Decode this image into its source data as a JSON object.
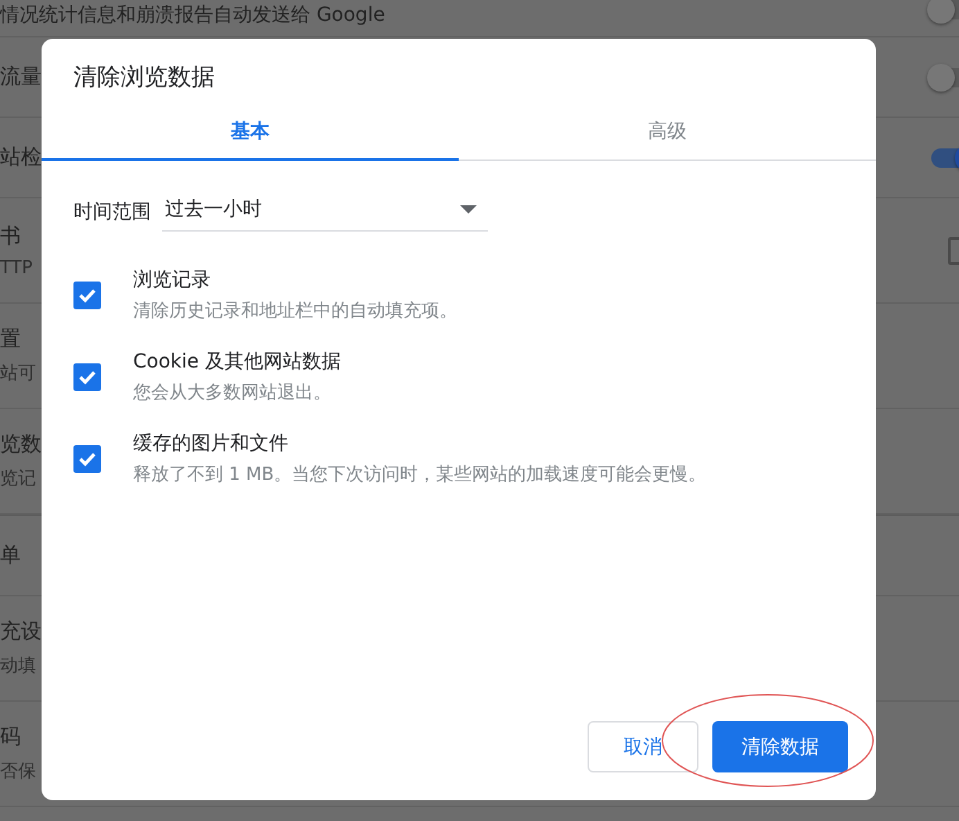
{
  "settings_sections": [
    {
      "rows": [
        {
          "title": "情况统计信息和崩溃报告自动发送给 Google",
          "control": {
            "kind": "toggle",
            "on": false
          }
        },
        {
          "title": "流量",
          "control": {
            "kind": "toggle",
            "on": false
          }
        },
        {
          "title": "站检",
          "control": {
            "kind": "toggle",
            "on": true
          }
        },
        {
          "title": "书",
          "subtitle": "TTP",
          "control": {
            "kind": "checkbox",
            "checked": false
          }
        },
        {
          "title": "置",
          "subtitle": "站可"
        },
        {
          "title": "览数",
          "subtitle": "览记"
        }
      ]
    },
    {
      "rows": [
        {
          "title": "单"
        },
        {
          "title": "充设",
          "subtitle": "动填"
        },
        {
          "title": "码",
          "subtitle": "否保"
        }
      ]
    }
  ],
  "dialog": {
    "title": "清除浏览数据",
    "tabs": [
      {
        "label": "基本",
        "selected": true
      },
      {
        "label": "高级",
        "selected": false
      }
    ],
    "time_range": {
      "label": "时间范围",
      "value": "过去一小时"
    },
    "options": [
      {
        "title": "浏览记录",
        "description": "清除历史记录和地址栏中的自动填充项。",
        "checked": true
      },
      {
        "title": "Cookie 及其他网站数据",
        "description": "您会从大多数网站退出。",
        "checked": true
      },
      {
        "title": "缓存的图片和文件",
        "description": "释放了不到 1 MB。当您下次访问时，某些网站的加载速度可能会更慢。",
        "checked": true
      }
    ],
    "buttons": [
      {
        "label": "取消",
        "kind": "secondary"
      },
      {
        "label": "清除数据",
        "kind": "primary"
      }
    ]
  }
}
